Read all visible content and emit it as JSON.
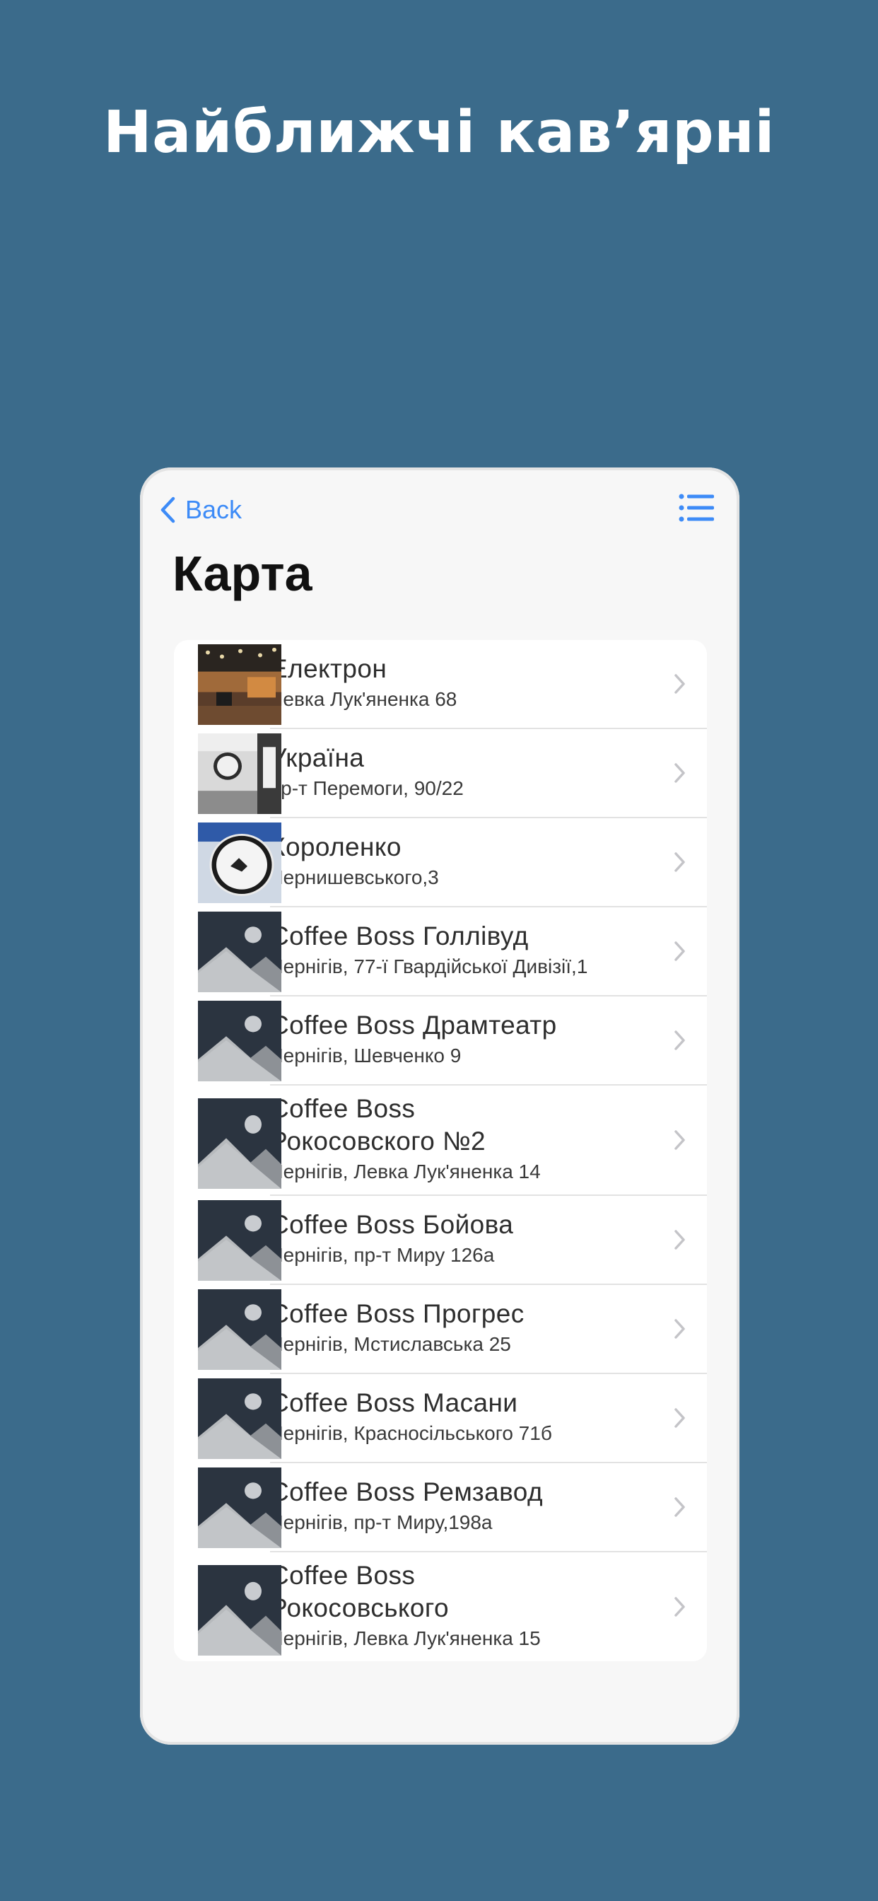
{
  "headline": "Найближчі кав’ярні",
  "nav": {
    "back_label": "Back"
  },
  "page_title": "Карта",
  "colors": {
    "background": "#3b6b8b",
    "accent": "#3d8bf7"
  },
  "cafes": [
    {
      "name": "Електрон",
      "address": "Левка Лук'яненка 68",
      "image": "photo-cafe-interior"
    },
    {
      "name": "Україна",
      "address": "пр-т Перемоги, 90/22",
      "image": "photo-cafe-storefront"
    },
    {
      "name": "Короленко",
      "address": "Чернишевського,3",
      "image": "photo-coffee-boss-sign"
    },
    {
      "name": "Coffee Boss Голлівуд",
      "address": "Чернігів, 77-ї Гвардійської Дивізії,1",
      "image": "placeholder-image-icon"
    },
    {
      "name": "Coffee Boss Драмтеатр",
      "address": "Чернігів, Шевченко 9",
      "image": "placeholder-image-icon"
    },
    {
      "name": "Coffee Boss Рокосовского №2",
      "address": "Чернігів, Левка Лук'яненка 14",
      "image": "placeholder-image-icon"
    },
    {
      "name": "Coffee Boss Бойова",
      "address": "Чернігів, пр-т Миру 126а",
      "image": "placeholder-image-icon"
    },
    {
      "name": "Coffee Boss Прогрес",
      "address": "Чернігів, Мстиславська 25",
      "image": "placeholder-image-icon"
    },
    {
      "name": "Coffee Boss Масани",
      "address": "Чернігів, Красносільського 71б",
      "image": "placeholder-image-icon"
    },
    {
      "name": "Coffee Boss Ремзавод",
      "address": "Чернігів, пр-т Миру,198а",
      "image": "placeholder-image-icon"
    },
    {
      "name": "Coffee Boss Рокосовського",
      "address": "Чернігів, Левка Лук'яненка 15",
      "image": "placeholder-image-icon"
    }
  ]
}
